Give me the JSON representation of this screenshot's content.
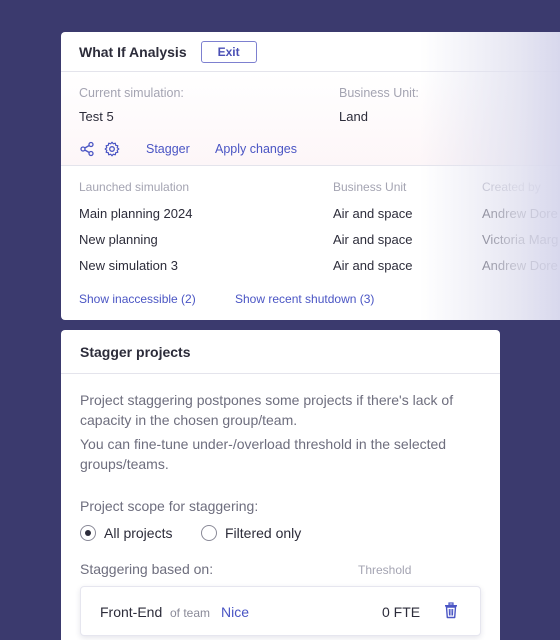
{
  "what_if": {
    "title": "What If Analysis",
    "exit_label": "Exit",
    "current_simulation_label": "Current simulation:",
    "current_simulation_value": "Test 5",
    "business_unit_label": "Business Unit:",
    "business_unit_value": "Land",
    "icons": [
      "share-icon",
      "gear-icon"
    ],
    "stagger_link": "Stagger",
    "apply_link": "Apply changes",
    "columns": [
      "Launched simulation",
      "Business Unit",
      "Created by"
    ],
    "rows": [
      {
        "simulation": "Main planning 2024",
        "unit": "Air and space",
        "creator": "Andrew Dore"
      },
      {
        "simulation": "New planning",
        "unit": "Air and space",
        "creator": "Victoria Marg"
      },
      {
        "simulation": "New simulation 3",
        "unit": "Air and space",
        "creator": "Andrew Dore"
      }
    ],
    "show_inaccessible": "Show inaccessible (2)",
    "show_recent_shutdown": "Show recent shutdown (3)"
  },
  "stagger": {
    "title": "Stagger projects",
    "desc_1": "Project staggering postpones some projects if there's lack of capacity in the chosen group/team.",
    "desc_2": "You can fine-tune under-/overload threshold in the selected groups/teams.",
    "scope_label": "Project scope for staggering:",
    "options": [
      {
        "label": "All projects",
        "checked": true
      },
      {
        "label": "Filtered only",
        "checked": false
      }
    ],
    "based_on_label": "Staggering based on:",
    "threshold_label": "Threshold",
    "team": {
      "name": "Front-End",
      "of_team": "of team",
      "team_link": "Nice",
      "threshold_value": "0 FTE"
    }
  },
  "colors": {
    "background": "#3b3a6e",
    "accent": "#4a55c4",
    "text": "#2c2c3a",
    "muted": "#a4a4b2"
  }
}
